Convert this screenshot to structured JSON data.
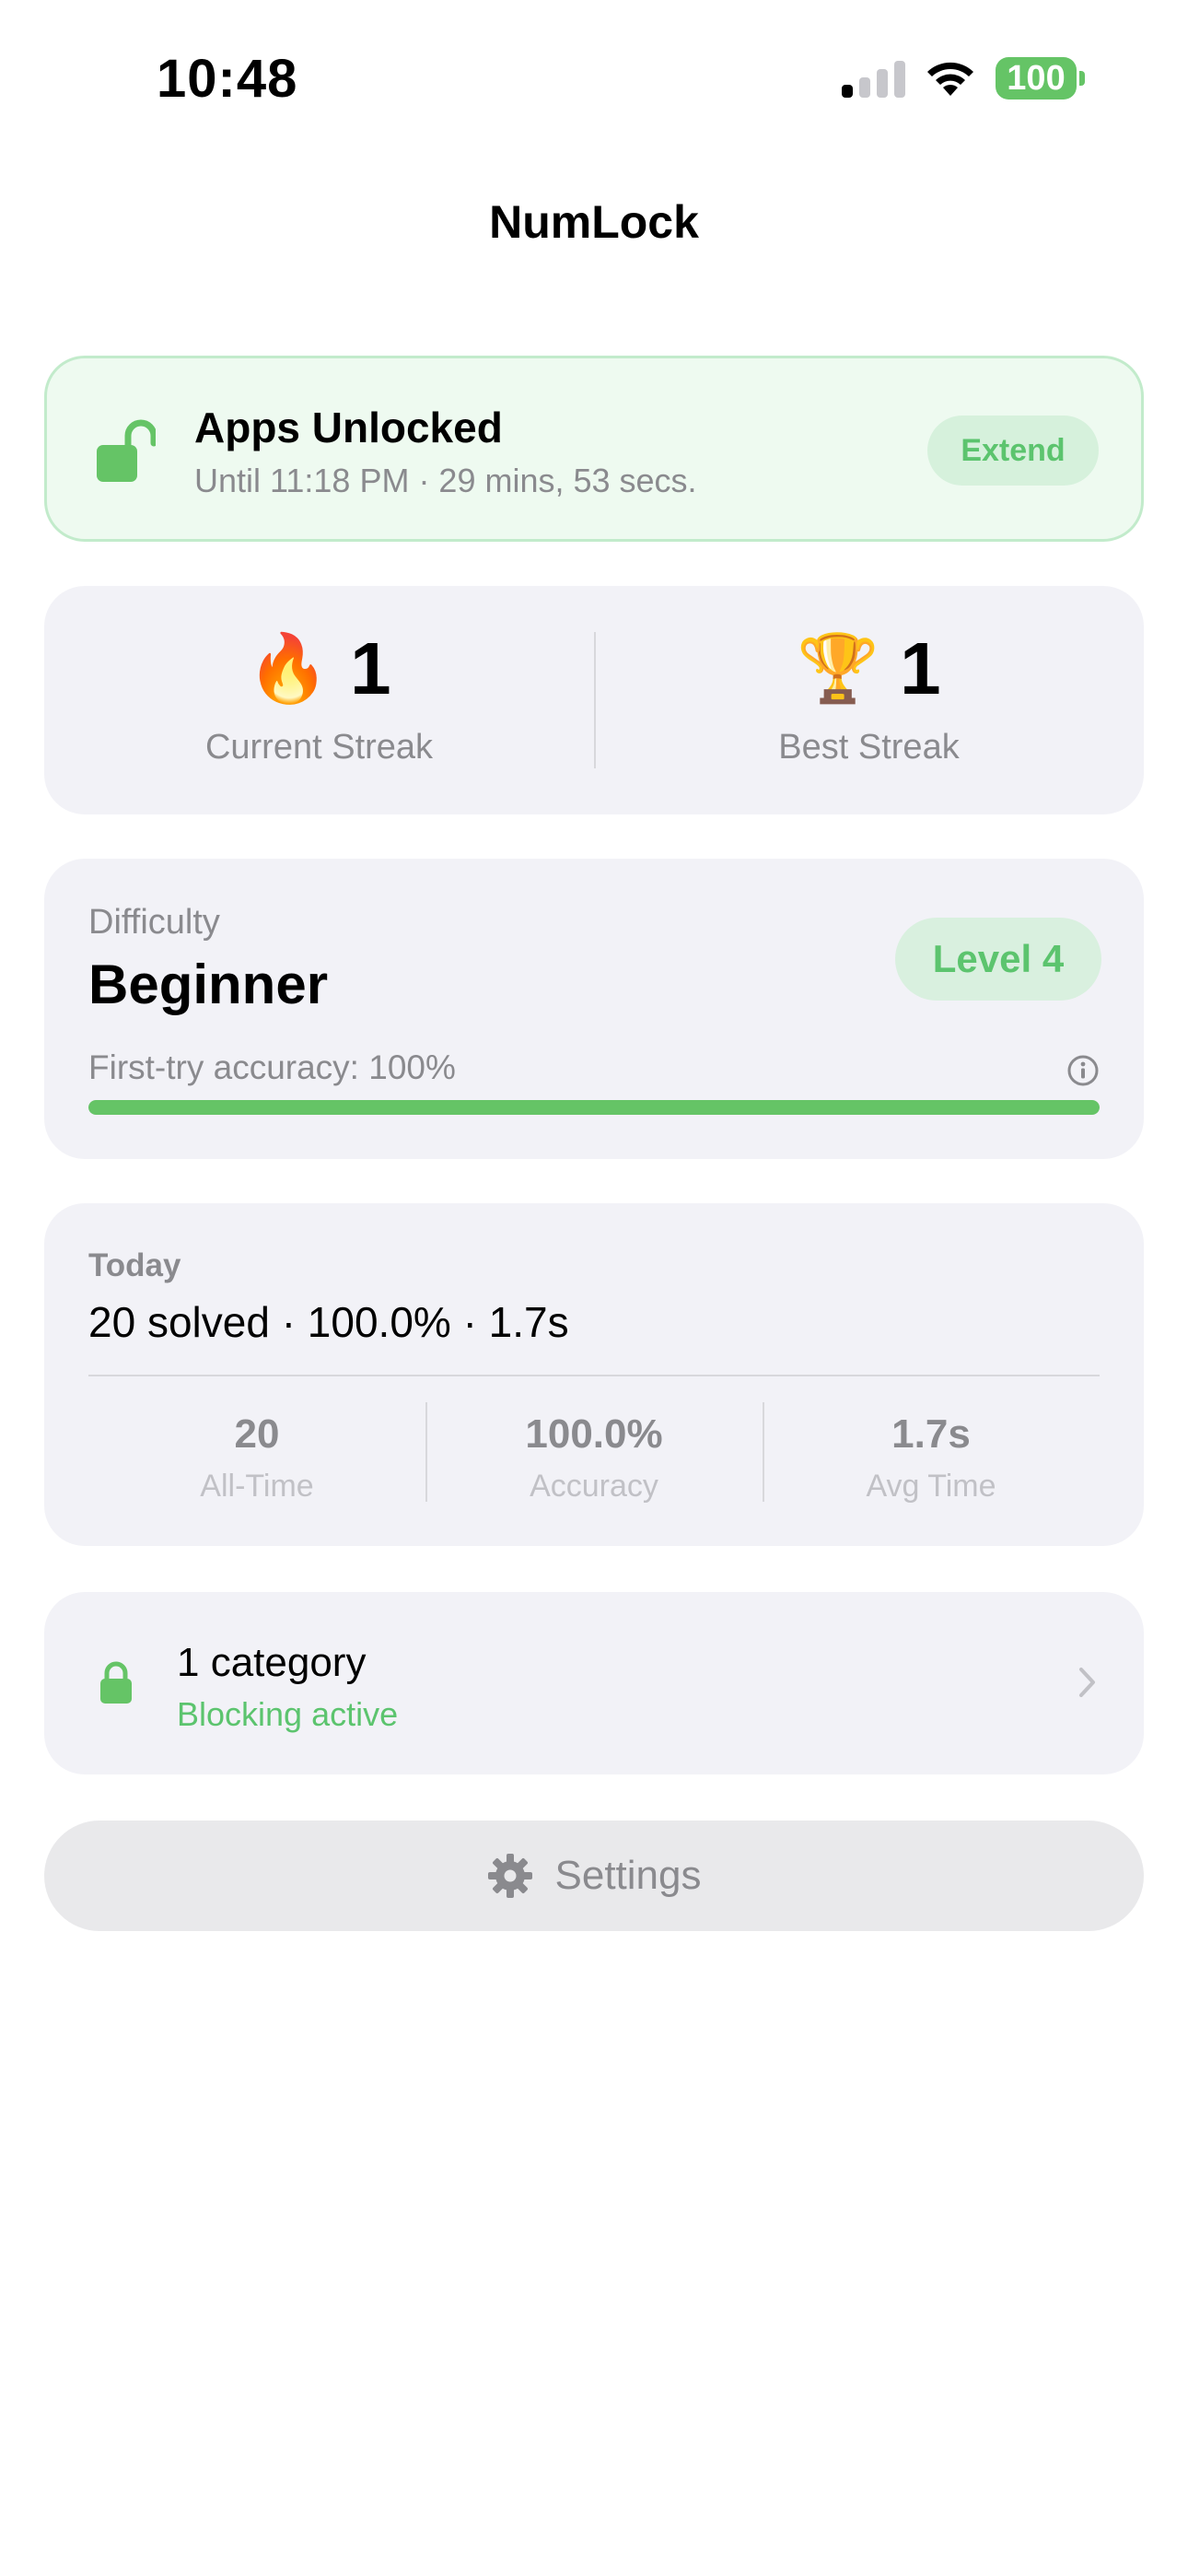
{
  "status_bar": {
    "time": "10:48",
    "battery": "100",
    "signal_bars_on": 1,
    "signal_bars_total": 4
  },
  "nav": {
    "title": "NumLock"
  },
  "unlock": {
    "icon": "lock-open-icon",
    "title": "Apps Unlocked",
    "subtitle": "Until 11:18 PM · 29 mins, 53 secs.",
    "extend_label": "Extend"
  },
  "streaks": {
    "current": {
      "emoji": "🔥",
      "value": "1",
      "label": "Current Streak"
    },
    "best": {
      "emoji": "🏆",
      "value": "1",
      "label": "Best Streak"
    }
  },
  "difficulty": {
    "label": "Difficulty",
    "value": "Beginner",
    "level": "Level 4",
    "accuracy_text": "First-try accuracy: 100%",
    "accuracy_fraction": 1.0
  },
  "today": {
    "label": "Today",
    "summary": "20 solved · 100.0% · 1.7s",
    "stats": [
      {
        "value": "20",
        "label": "All-Time"
      },
      {
        "value": "100.0%",
        "label": "Accuracy"
      },
      {
        "value": "1.7s",
        "label": "Avg Time"
      }
    ]
  },
  "category": {
    "icon": "lock-icon",
    "title": "1 category",
    "status": "Blocking active"
  },
  "settings": {
    "icon": "gear-icon",
    "label": "Settings"
  },
  "colors": {
    "accent_green": "#65c466",
    "card_bg": "#f2f2f7",
    "unlock_bg": "#eefaf0",
    "secondary_text": "#8a8a8e"
  }
}
